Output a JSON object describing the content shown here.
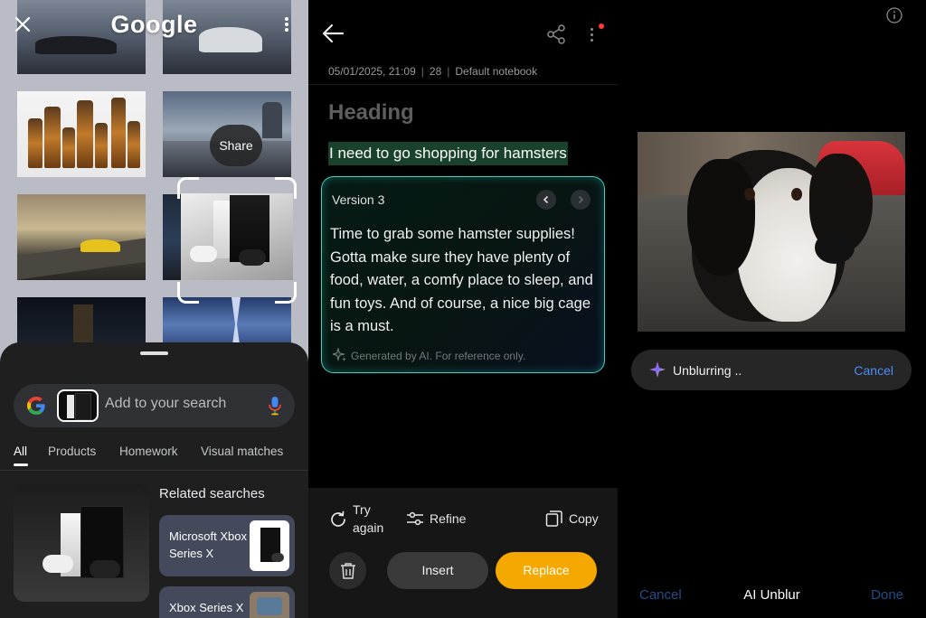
{
  "lens": {
    "title": "Google",
    "share_label": "Share",
    "search_placeholder": "Add to your search",
    "tabs": [
      {
        "label": "All"
      },
      {
        "label": "Products"
      },
      {
        "label": "Homework"
      },
      {
        "label": "Visual matches"
      }
    ],
    "related_title": "Related searches",
    "related": [
      {
        "label": "Microsoft Xbox Series X"
      },
      {
        "label": "Xbox Series X"
      }
    ],
    "icons": [
      "close-icon",
      "more-vert-icon",
      "google-g-icon",
      "mic-icon"
    ],
    "colors": {
      "sheet": "#1f1f20",
      "search_bar": "#303134",
      "related_card": "#444a5c"
    }
  },
  "notes": {
    "meta": {
      "date": "05/01/2025, 21:09",
      "count": "28",
      "notebook": "Default notebook"
    },
    "heading": "Heading",
    "highlighted_text": "I need to go shopping for hamsters",
    "version_label": "Version 3",
    "version_text": "Time to grab some hamster supplies! Gotta make sure they have plenty of food, water, a comfy place to sleep, and fun toys.  And of course, a nice big cage is a must.",
    "ai_note": "Generated by AI. For reference only.",
    "actions": {
      "try_again_line1": "Try",
      "try_again_line2": "again",
      "refine": "Refine",
      "copy": "Copy",
      "insert": "Insert",
      "replace": "Replace"
    },
    "icons": [
      "back-arrow-icon",
      "share-icon",
      "more-vert-icon",
      "sparkle-icon",
      "refresh-icon",
      "sliders-icon",
      "copy-icon",
      "trash-icon"
    ],
    "colors": {
      "highlight": "#18422c",
      "version_border": "#33d6c6",
      "replace_button": "#f5a800"
    }
  },
  "unblur": {
    "status": "Unblurring ..",
    "pill_cancel": "Cancel",
    "bottom_cancel": "Cancel",
    "bottom_title": "AI Unblur",
    "bottom_done": "Done",
    "icons": [
      "info-icon",
      "sparkle-icon"
    ],
    "colors": {
      "accent": "#4c8df6",
      "muted_accent": "#1f4f8a"
    }
  }
}
